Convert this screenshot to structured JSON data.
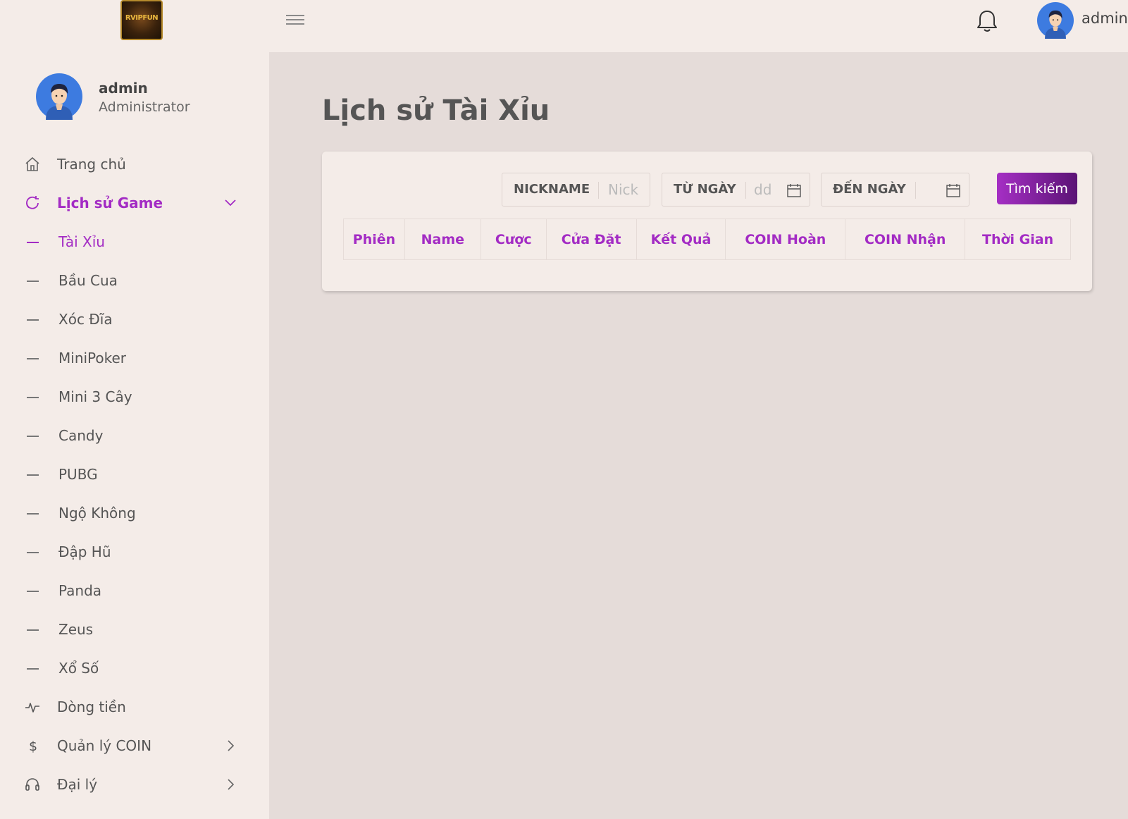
{
  "header": {
    "logo_text": "RVIPFUN",
    "user_name": "admin"
  },
  "sidebar": {
    "profile": {
      "name": "admin",
      "role": "Administrator"
    },
    "items": [
      {
        "label": "Trang chủ",
        "icon": "home-icon"
      },
      {
        "label": "Lịch sử Game",
        "icon": "history-icon",
        "expanded": true
      },
      {
        "label": "Dòng tiền",
        "icon": "activity-icon"
      },
      {
        "label": "Quản lý COIN",
        "icon": "dollar-icon"
      },
      {
        "label": "Đại lý",
        "icon": "headset-icon"
      }
    ],
    "sub_items": [
      "Tài Xỉu",
      "Bầu Cua",
      "Xóc Đĩa",
      "MiniPoker",
      "Mini 3 Cây",
      "Candy",
      "PUBG",
      "Ngộ Không",
      "Đập Hũ",
      "Panda",
      "Zeus",
      "Xổ Số"
    ]
  },
  "main": {
    "title": "Lịch sử Tài Xỉu",
    "filters": {
      "nickname_label": "NICKNAME",
      "nickname_placeholder": "Nick",
      "from_label": "TỪ NGÀY",
      "from_placeholder": "dd",
      "to_label": "ĐẾN NGÀY",
      "search_label": "Tìm kiếm"
    },
    "table": {
      "columns": [
        "Phiên",
        "Name",
        "Cược",
        "Cửa Đặt",
        "Kết Quả",
        "COIN Hoàn",
        "COIN Nhận",
        "Thời Gian"
      ],
      "rows": []
    }
  },
  "colors": {
    "accent": "#a32bc4",
    "button_gradient_end": "#5b1375",
    "background": "#e5dcd9",
    "panel": "#f4ece8"
  }
}
